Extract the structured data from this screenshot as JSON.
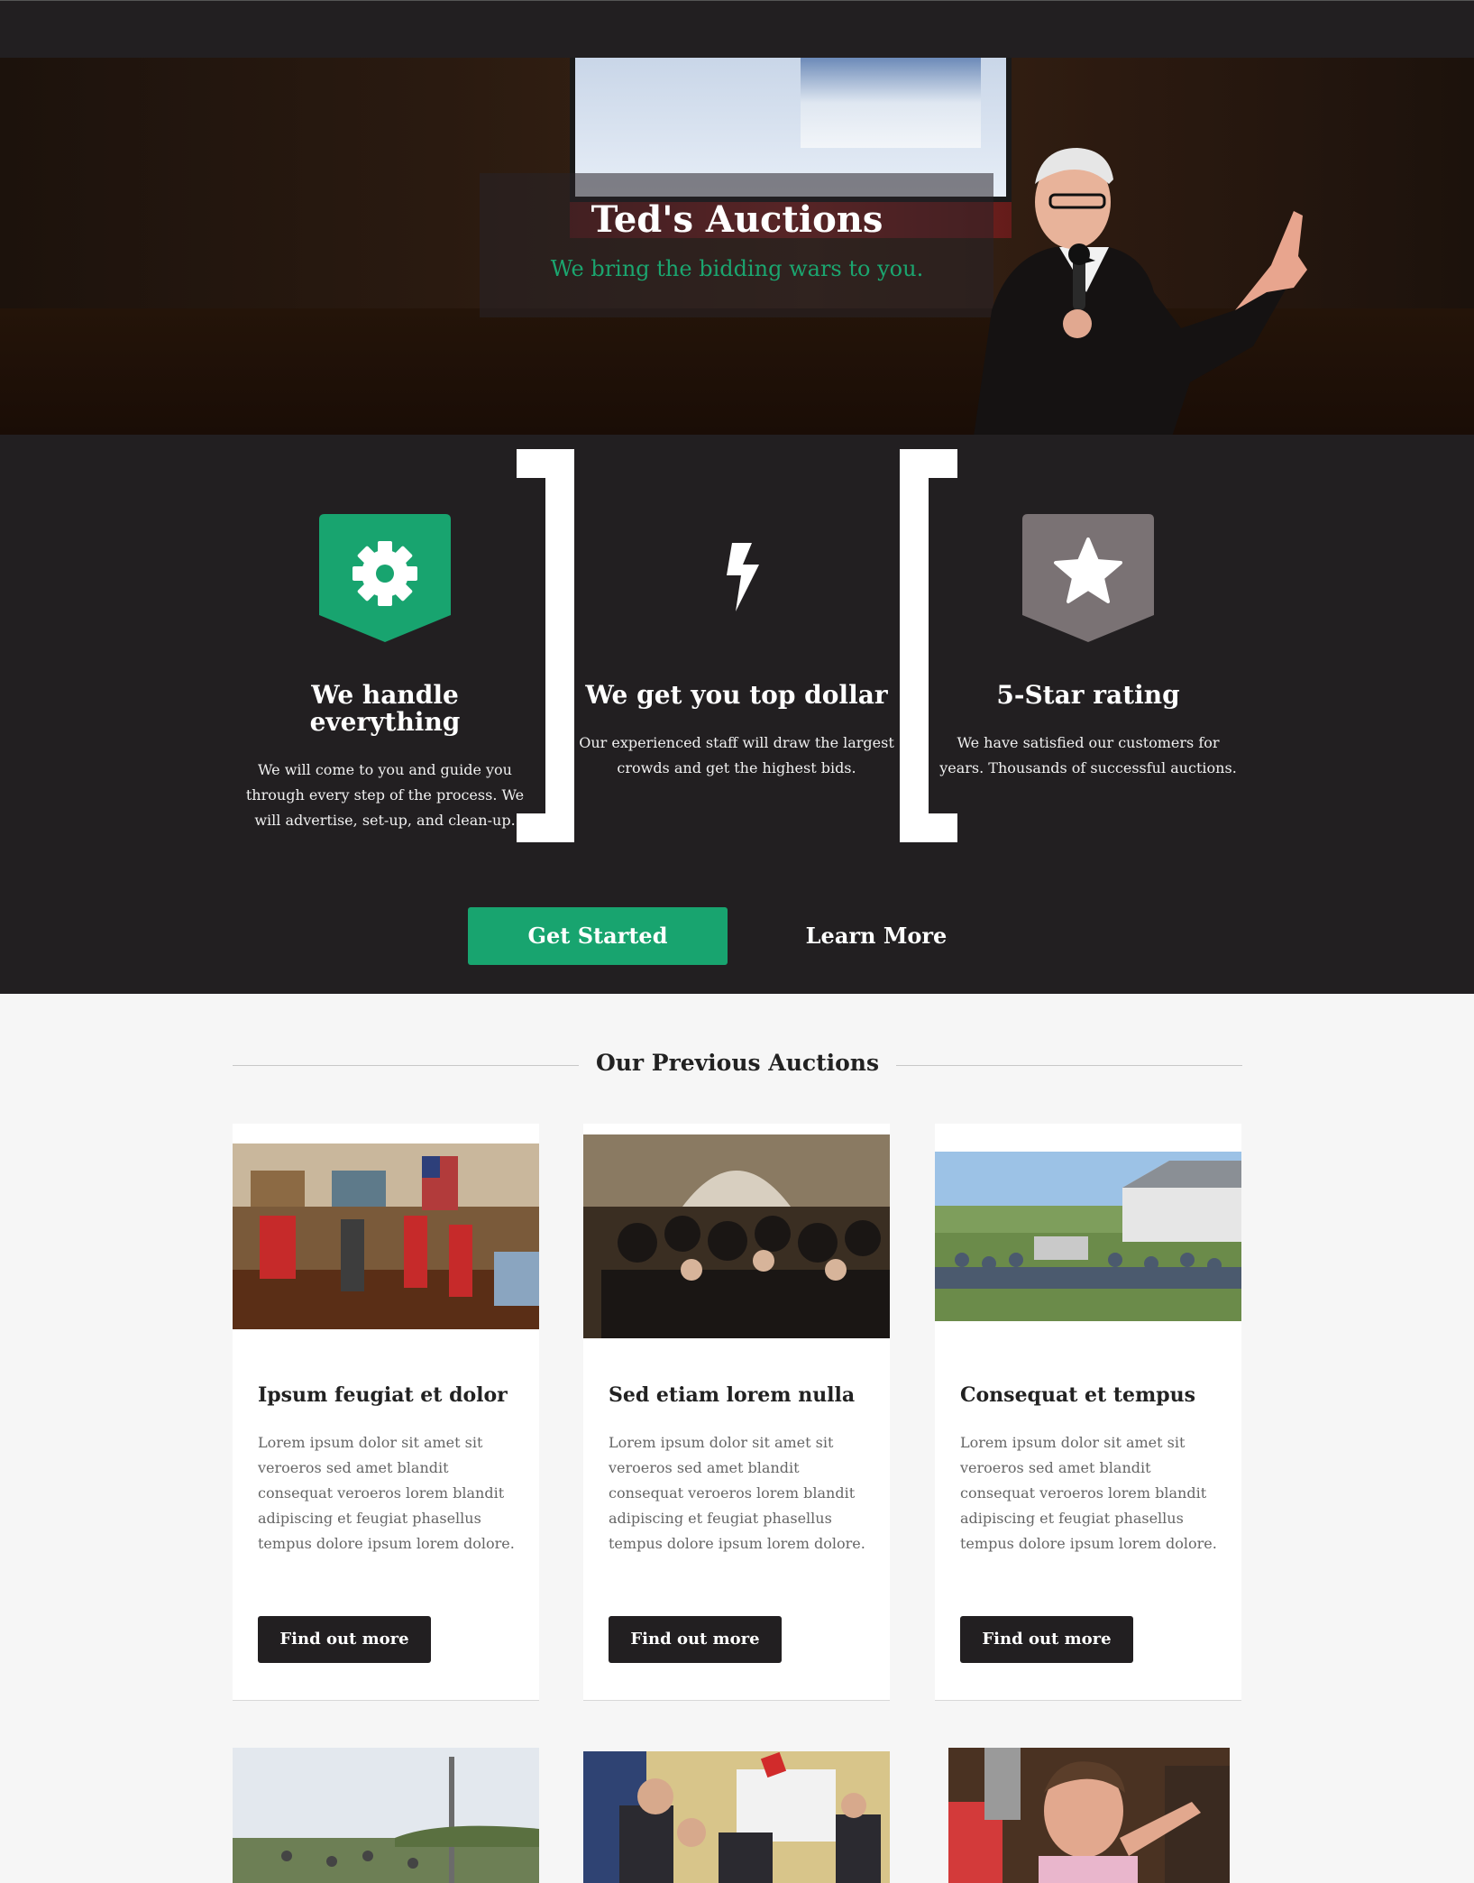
{
  "hero": {
    "title": "Ted's Auctions",
    "tagline": "We bring the bidding wars to you."
  },
  "features": [
    {
      "icon": "gear-icon",
      "title": "We handle everything",
      "text": "We will come to you and guide you through every step of the process. We will advertise, set-up, and clean-up.",
      "badge_color": "#18a46f"
    },
    {
      "icon": "bolt-icon",
      "title": "We get you top dollar",
      "text": "Our experienced staff will draw the largest crowds and get the highest bids.",
      "badge_color": "none"
    },
    {
      "icon": "star-icon",
      "title": "5-Star rating",
      "text": "We have satisfied our customers for years. Thousands of successful auctions.",
      "badge_color": "#7a7274"
    }
  ],
  "buttons": {
    "get_started": "Get Started",
    "learn_more": "Learn More"
  },
  "previous": {
    "heading": "Our Previous Auctions",
    "cards": [
      {
        "title": "Ipsum feugiat et dolor",
        "text": "Lorem ipsum dolor sit amet sit veroeros sed amet blandit consequat veroeros lorem blandit adipiscing et feugiat phasellus tempus dolore ipsum lorem dolore.",
        "button": "Find out more"
      },
      {
        "title": "Sed etiam lorem nulla",
        "text": "Lorem ipsum dolor sit amet sit veroeros sed amet blandit consequat veroeros lorem blandit adipiscing et feugiat phasellus tempus dolore ipsum lorem dolore.",
        "button": "Find out more"
      },
      {
        "title": "Consequat et tempus",
        "text": "Lorem ipsum dolor sit amet sit veroeros sed amet blandit consequat veroeros lorem blandit adipiscing et feugiat phasellus tempus dolore ipsum lorem dolore.",
        "button": "Find out more"
      }
    ]
  },
  "colors": {
    "accent": "#18a46f",
    "dark": "#221f21",
    "grey_badge": "#7a7274"
  }
}
